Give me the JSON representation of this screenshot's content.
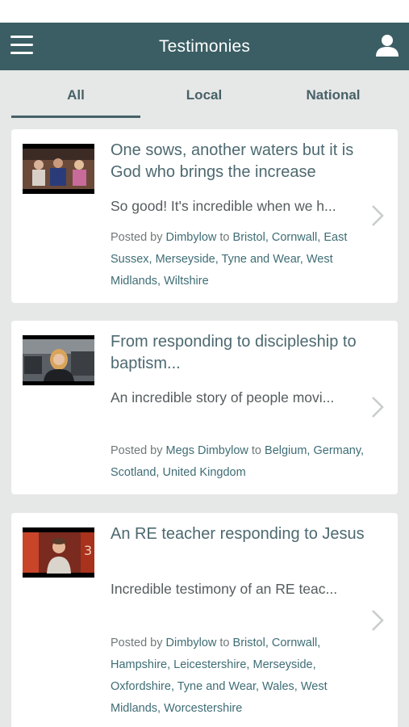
{
  "app": {
    "title": "Testimonies",
    "menu_icon": "hamburger-menu-icon",
    "profile_icon": "user-profile-icon",
    "brand_color": "#3a5e63"
  },
  "tabs": [
    {
      "label": "All",
      "selected": true
    },
    {
      "label": "Local",
      "selected": false
    },
    {
      "label": "National",
      "selected": false
    }
  ],
  "cards": [
    {
      "title": "One sows, another waters but it is God who brings the increase",
      "excerpt": "So good! It's incredible when we h...",
      "posted_by_label": "Posted by",
      "author": "Dimbylow",
      "to_label": "to",
      "locations": "Bristol, Cornwall, East Sussex, Merseyside, Tyne and Wear, West Midlands, Wiltshire"
    },
    {
      "title": "From responding to discipleship to baptism...",
      "excerpt": "An incredible story of people movi...",
      "posted_by_label": "Posted by",
      "author": "Megs Dimbylow",
      "to_label": "to",
      "locations": "Belgium, Germany, Scotland, United Kingdom"
    },
    {
      "title": "An RE teacher responding to Jesus",
      "excerpt": "Incredible testimony of an RE teac...",
      "posted_by_label": "Posted by",
      "author": "Dimbylow",
      "to_label": "to",
      "locations": "Bristol, Cornwall, Hampshire, Leicestershire, Merseyside, Oxfordshire, Tyne and Wear, Wales, West Midlands, Worcestershire"
    }
  ]
}
